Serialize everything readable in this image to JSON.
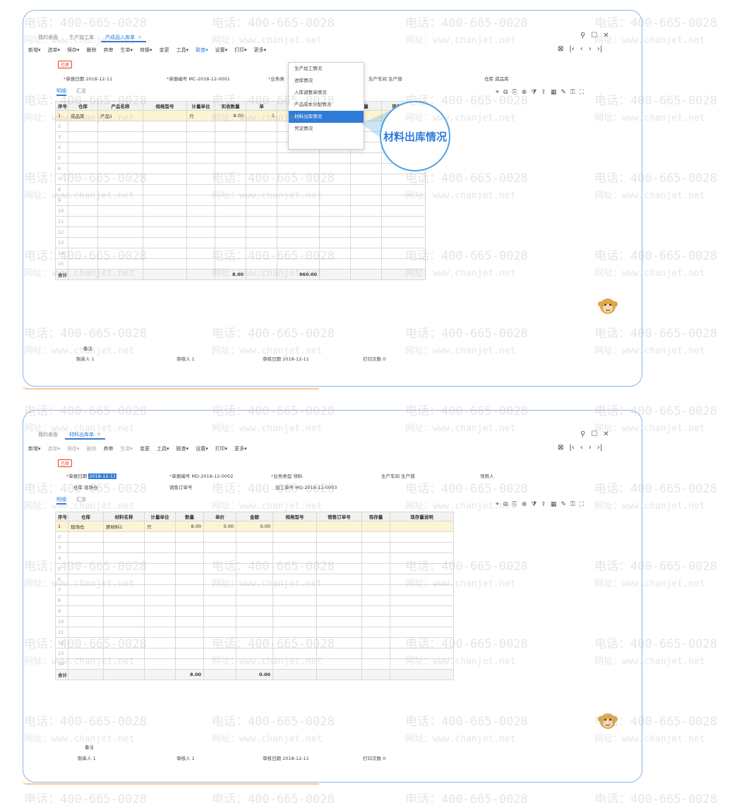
{
  "watermark": {
    "phone": "电话：400-665-0028",
    "web": "网址：www.chanjet.net"
  },
  "screen1": {
    "tabs": [
      {
        "label": "我的桌面"
      },
      {
        "label": "生产加工单"
      },
      {
        "label": "产成品入库单",
        "active": true
      }
    ],
    "toolbar": [
      "新增▾",
      "选单▾",
      "保存▾",
      "删除",
      "弃审",
      "生单▾",
      "转换▾",
      "变更",
      "工具▾",
      "联查▾",
      "设置▾",
      "打印▾",
      "更多▾"
    ],
    "badge": "已审",
    "fields": {
      "date_label": "单据日期",
      "date_value": "2018-12-11",
      "code_label": "单据编号",
      "code_value": "MC-2018-12-0001",
      "biz_label": "业务类",
      "dept_label": "生产车间",
      "dept_value": "生产部",
      "wh_label": "仓库",
      "wh_value": "成品库"
    },
    "subtabs": [
      "明细",
      "汇总"
    ],
    "columns": [
      "序号",
      "仓库",
      "产品名称",
      "规格型号",
      "计量单位",
      "实收数量",
      "单",
      "金额",
      "批号",
      "量",
      "现存量说明"
    ],
    "rows": [
      {
        "idx": "1",
        "wh": "成品库",
        "name": "产品1",
        "spec": "",
        "unit": "只",
        "qty": "8.00",
        "price": "1"
      },
      {
        "idx": "2"
      },
      {
        "idx": "3"
      },
      {
        "idx": "4"
      },
      {
        "idx": "5"
      },
      {
        "idx": "6"
      },
      {
        "idx": "7"
      },
      {
        "idx": "8"
      },
      {
        "idx": "9"
      },
      {
        "idx": "10"
      },
      {
        "idx": "11"
      },
      {
        "idx": "12"
      },
      {
        "idx": "13"
      },
      {
        "idx": "14"
      },
      {
        "idx": "15"
      }
    ],
    "total": {
      "label": "合计",
      "qty": "8.00",
      "amount": "960.00"
    },
    "footer": {
      "remark_label": "备注",
      "maker_label": "制单人",
      "maker_value": "1",
      "auditor_label": "审核人",
      "auditor_value": "1",
      "audit_date_label": "审核日期",
      "audit_date_value": "2018-12-11",
      "print_label": "打印次数",
      "print_value": "0"
    },
    "dropdown": [
      {
        "label": "生产加工情况"
      },
      {
        "label": "进库情况"
      },
      {
        "label": "入库调整单情况"
      },
      {
        "label": "产品成本分配情况"
      },
      {
        "label": "材料出库情况",
        "highlight": true
      },
      {
        "label": "凭证情况"
      }
    ],
    "zoom_label": "材料出库情况"
  },
  "screen2": {
    "tabs": [
      {
        "label": "我的桌面"
      },
      {
        "label": "材料出库单",
        "active": true
      }
    ],
    "toolbar": [
      "新增▾",
      "选单▾",
      "保存▾",
      "删除",
      "弃审",
      "生单▾",
      "变更",
      "工具▾",
      "联查▾",
      "设置▾",
      "打印▾",
      "更多▾"
    ],
    "badge": "已审",
    "fields": {
      "date_label": "单据日期",
      "date_value": "2018-12-11",
      "code_label": "单据编号",
      "code_value": "MD-2018-12-0002",
      "biz_label": "业务类型",
      "biz_value": "领料",
      "dept_label": "生产车间",
      "dept_value": "生产部",
      "user_label": "领用人",
      "wh_label": "仓库",
      "wh_value": "现场仓",
      "sales_label": "销售订单号",
      "proc_label": "加工单号",
      "proc_value": "MO-2018-12-0003"
    },
    "subtabs": [
      "明细",
      "汇总"
    ],
    "columns": [
      "序号",
      "仓库",
      "材料名称",
      "计量单位",
      "数量",
      "单价",
      "金额",
      "规格型号",
      "销售订单号",
      "现存量",
      "现存量说明"
    ],
    "rows": [
      {
        "idx": "1",
        "wh": "现场仓",
        "name": "原材料1",
        "unit": "只",
        "qty": "8.00",
        "price": "0.00",
        "amount": "0.00"
      },
      {
        "idx": "2"
      },
      {
        "idx": "3"
      },
      {
        "idx": "4"
      },
      {
        "idx": "5"
      },
      {
        "idx": "6"
      },
      {
        "idx": "7"
      },
      {
        "idx": "8"
      },
      {
        "idx": "9"
      },
      {
        "idx": "10"
      },
      {
        "idx": "11"
      },
      {
        "idx": "12"
      },
      {
        "idx": "13"
      },
      {
        "idx": "14"
      }
    ],
    "total": {
      "label": "合计",
      "qty": "8.00",
      "amount": "0.00"
    },
    "footer": {
      "remark_label": "备注",
      "maker_label": "制单人",
      "maker_value": "1",
      "auditor_label": "审核人",
      "auditor_value": "1",
      "audit_date_label": "审核日期",
      "audit_date_value": "2018-12-11",
      "print_label": "打印次数",
      "print_value": "0"
    }
  },
  "colors": {
    "accent": "#2f7bd8",
    "required": "#e23a2a",
    "selected_row": "#fdf4d3",
    "panel_border": "#8fb4e0"
  },
  "icons": [
    "search-icon",
    "maximize-icon",
    "close-icon",
    "first-page-icon",
    "prev-icon",
    "next-icon",
    "last-page-icon",
    "location-icon",
    "copy-icon",
    "mascot-icon"
  ]
}
